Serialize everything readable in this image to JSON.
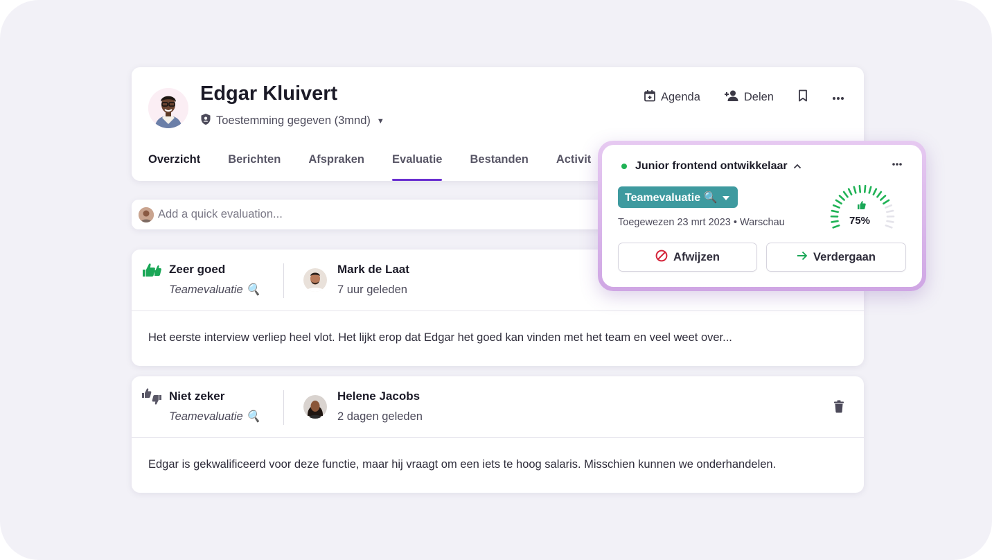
{
  "candidate": {
    "name": "Edgar Kluivert",
    "consent": "Toestemming gegeven (3mnd)"
  },
  "header_actions": {
    "agenda": "Agenda",
    "share": "Delen"
  },
  "tabs": [
    "Overzicht",
    "Berichten",
    "Afspraken",
    "Evaluatie",
    "Bestanden",
    "Activit"
  ],
  "quick_eval": {
    "placeholder": "Add a quick evaluation..."
  },
  "evaluations": [
    {
      "rating": "Zeer goed",
      "type": "Teamevaluatie 🔍",
      "reviewer": "Mark de Laat",
      "time": "7 uur geleden",
      "text": "Het eerste interview verliep heel vlot. Het lijkt erop dat Edgar het goed kan vinden met het team en veel weet over..."
    },
    {
      "rating": "Niet zeker",
      "type": "Teamevaluatie 🔍",
      "reviewer": "Helene Jacobs",
      "time": "2 dagen geleden",
      "text": "Edgar is gekwalificeerd voor deze functie, maar hij vraagt om een iets te hoog salaris. Misschien kunnen we onderhandelen."
    }
  ],
  "popup": {
    "job": "Junior frontend ontwikkelaar",
    "stage": "Teamevaluatie 🔍",
    "assigned_date": "Toegewezen 23 mrt 2023",
    "location": "Warschau",
    "score": "75%",
    "score_value": 0.75,
    "reject": "Afwijzen",
    "proceed": "Verdergaan"
  },
  "colors": {
    "accent": "#6a2fd0",
    "positive": "#1fb255",
    "stage_badge": "#3e9a9f",
    "reject_icon": "#d4243a"
  }
}
